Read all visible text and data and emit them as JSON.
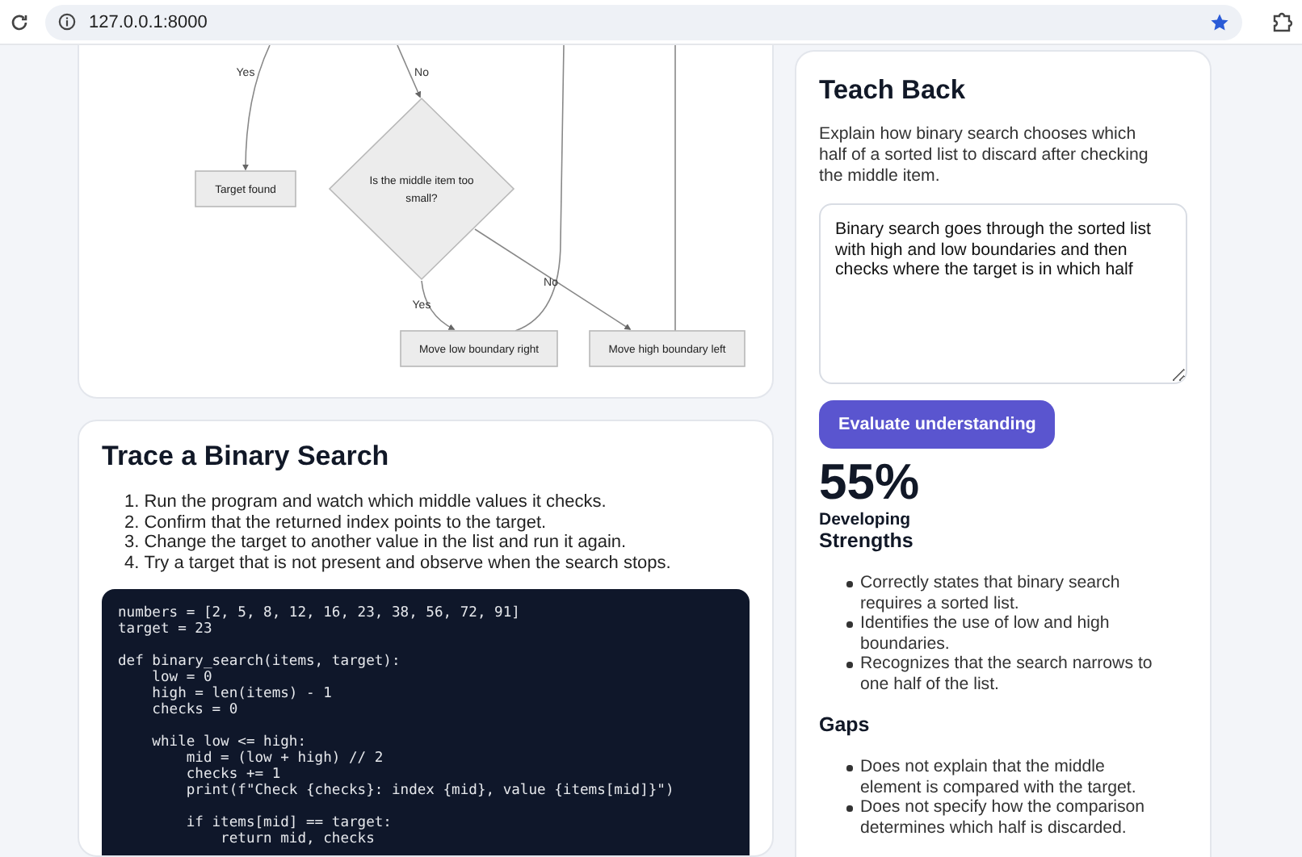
{
  "browser": {
    "url": "127.0.0.1:8000"
  },
  "flowchart": {
    "nodes": [
      {
        "kind": "process",
        "label": "Target found"
      },
      {
        "kind": "decision",
        "label": "Is the middle item too small?"
      },
      {
        "kind": "process",
        "label": "Move low boundary right"
      },
      {
        "kind": "process",
        "label": "Move high boundary left"
      }
    ],
    "edge_labels": [
      "Yes",
      "No",
      "Yes",
      "No"
    ]
  },
  "trace": {
    "title": "Trace a Binary Search",
    "steps": [
      {
        "number": "1.",
        "text": "Run the program and watch which middle values it checks."
      },
      {
        "number": "2.",
        "text": "Confirm that the returned index points to the target."
      },
      {
        "number": "3.",
        "text": "Change the target to another value in the list and run it again."
      },
      {
        "number": "4.",
        "text": "Try a target that is not present and observe when the search stops."
      }
    ],
    "code": "numbers = [2, 5, 8, 12, 16, 23, 38, 56, 72, 91]\ntarget = 23\n\ndef binary_search(items, target):\n    low = 0\n    high = len(items) - 1\n    checks = 0\n\n    while low <= high:\n        mid = (low + high) // 2\n        checks += 1\n        print(f\"Check {checks}: index {mid}, value {items[mid]}\")\n\n        if items[mid] == target:\n            return mid, checks"
  },
  "teach_back": {
    "title": "Teach Back",
    "prompt": "Explain how binary search chooses which half of a sorted list to discard after checking the middle item.",
    "answer": "Binary search goes through the sorted list with high and low boundaries and then checks where the target is in which half",
    "button": "Evaluate understanding",
    "score": "55%",
    "rating": "Developing",
    "strengths_title": "Strengths",
    "strengths": [
      "Correctly states that binary search requires a sorted list.",
      "Identifies the use of low and high boundaries.",
      "Recognizes that the search narrows to one half of the list."
    ],
    "gaps_title": "Gaps",
    "gaps": [
      "Does not explain that the middle element is compared with the target.",
      "Does not specify how the comparison determines which half is discarded."
    ]
  }
}
